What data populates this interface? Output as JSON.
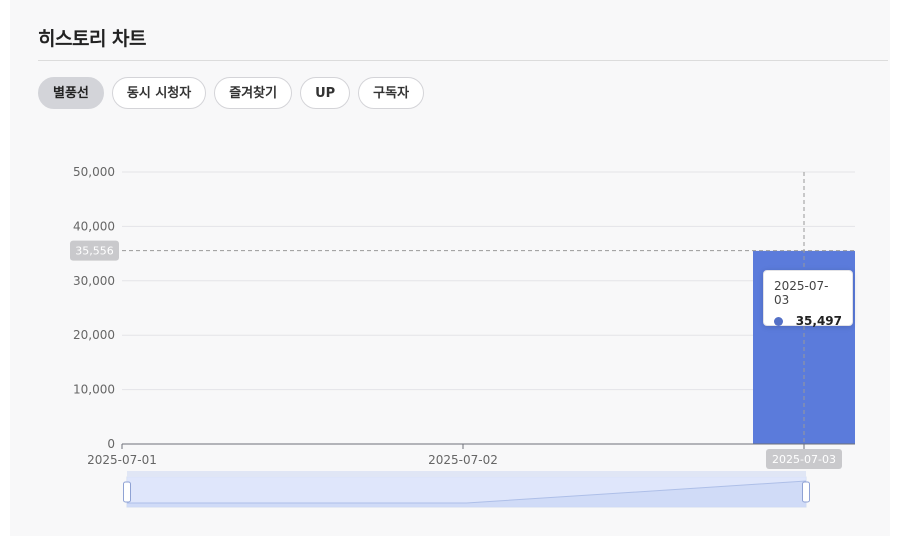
{
  "section": {
    "title": "히스토리 차트"
  },
  "tabs": [
    {
      "label": "별풍선",
      "active": true
    },
    {
      "label": "동시 시청자",
      "active": false
    },
    {
      "label": "즐겨찾기",
      "active": false
    },
    {
      "label": "UP",
      "active": false
    },
    {
      "label": "구독자",
      "active": false
    }
  ],
  "chart_data": {
    "type": "bar",
    "x": [
      "2025-07-01",
      "2025-07-02",
      "2025-07-03"
    ],
    "values": [
      0,
      0,
      35497
    ],
    "ylim": [
      0,
      50000
    ],
    "yticks": [
      "0",
      "10,000",
      "20,000",
      "30,000",
      "40,000",
      "50,000"
    ],
    "ytick_values": [
      0,
      10000,
      20000,
      30000,
      40000,
      50000
    ],
    "grid": true,
    "bar_color": "#5b7bdb",
    "crosshair": {
      "y_label": "35,556",
      "y_value": 35556,
      "x_label": "2025-07-03"
    },
    "tooltip": {
      "date": "2025-07-03",
      "value": "35,497",
      "marker_color": "#5470c6"
    },
    "data_zoom": {
      "start": 0,
      "end": 100
    }
  }
}
